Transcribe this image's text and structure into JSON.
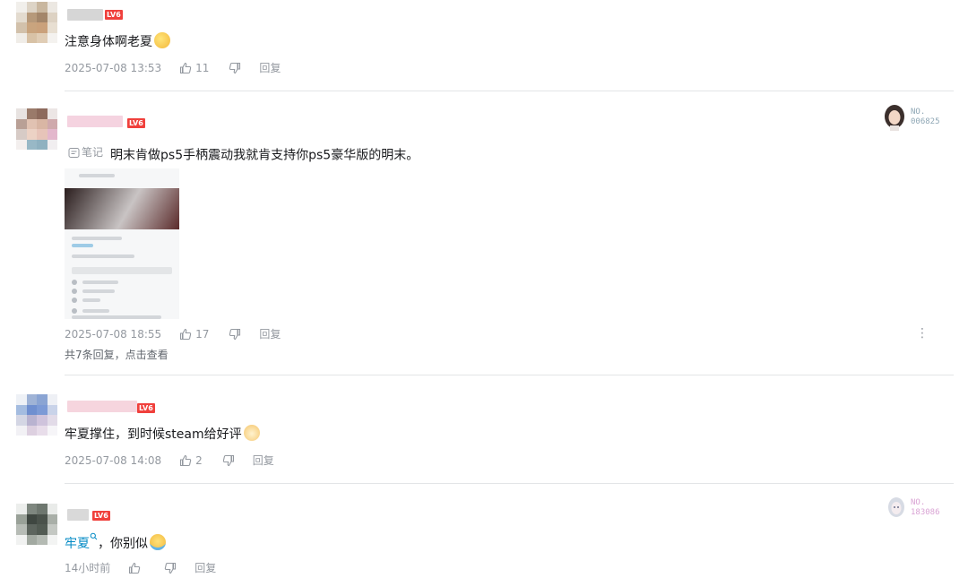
{
  "comments": [
    {
      "level": "LV6",
      "text": "注意身体啊老夏",
      "emoji": "sweat-face-emoji",
      "time": "2025-07-08 13:53",
      "likes": "11",
      "reply_label": "回复"
    },
    {
      "level": "LV6",
      "note_tag": "笔记",
      "text": "明末肯做ps5手柄震动我就肯支持你ps5豪华版的明末。",
      "time": "2025-07-08 18:55",
      "likes": "17",
      "reply_label": "回复",
      "view_replies": "共7条回复，点击查看",
      "badge_no": "NO.\n006825",
      "more_icon": "more-icon"
    },
    {
      "level": "LV6",
      "text": "牢夏撑住，到时候steam给好评",
      "emoji": "dog-face-emoji",
      "time": "2025-07-08 14:08",
      "likes": "2",
      "reply_label": "回复"
    },
    {
      "level": "LV6",
      "mention": "牢夏",
      "text": "，你别似",
      "emoji": "crying-face-emoji",
      "time": "14小时前",
      "likes": "",
      "reply_label": "回复",
      "badge_no": "NO.\n183086"
    }
  ],
  "colors": {
    "level_badge": "#f0403c",
    "meta_text": "#9499a0",
    "mention": "#008ac5",
    "divider": "#e3e5e7"
  }
}
